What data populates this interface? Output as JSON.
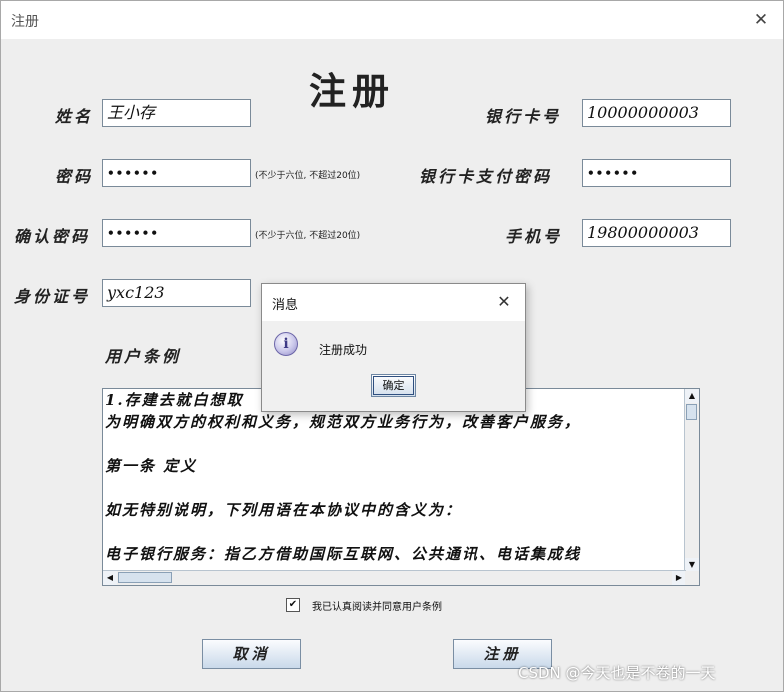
{
  "window": {
    "title": "注册",
    "close_glyph": "✕"
  },
  "heading": "注册",
  "form": {
    "name": {
      "label": "姓名",
      "value": "王小存"
    },
    "password": {
      "label": "密码",
      "value": "••••••",
      "hint": "(不少于六位, 不超过20位)"
    },
    "confirm_password": {
      "label": "确认密码",
      "value": "••••••",
      "hint": "(不少于六位, 不超过20位)"
    },
    "id_number": {
      "label": "身份证号",
      "value": "yxc123"
    },
    "bank_card": {
      "label": "银行卡号",
      "value": "10000000003"
    },
    "bank_pay_password": {
      "label": "银行卡支付密码",
      "value": "••••••"
    },
    "phone": {
      "label": "手机号",
      "value": "19800000003"
    }
  },
  "terms": {
    "label": "用户条例",
    "lines": [
      "1.存建去就白想取",
      "为明确双方的权利和义务，规范双方业务行为，改善客户服务，",
      "",
      "第一条 定义",
      "",
      "如无特别说明，下列用语在本协议中的含义为：",
      "",
      "电子银行服务：指乙方借助国际互联网、公共通讯、电话集成线"
    ]
  },
  "agreement": {
    "checked": true,
    "check_glyph": "✔",
    "label": "我已认真阅读并同意用户条例"
  },
  "buttons": {
    "cancel": "取消",
    "register": "注册"
  },
  "dialog": {
    "title": "消息",
    "close_glyph": "✕",
    "icon": "info-icon",
    "icon_glyph": "i",
    "message": "注册成功",
    "ok": "确定"
  },
  "watermark": "CSDN @今天也是不卷的一天"
}
